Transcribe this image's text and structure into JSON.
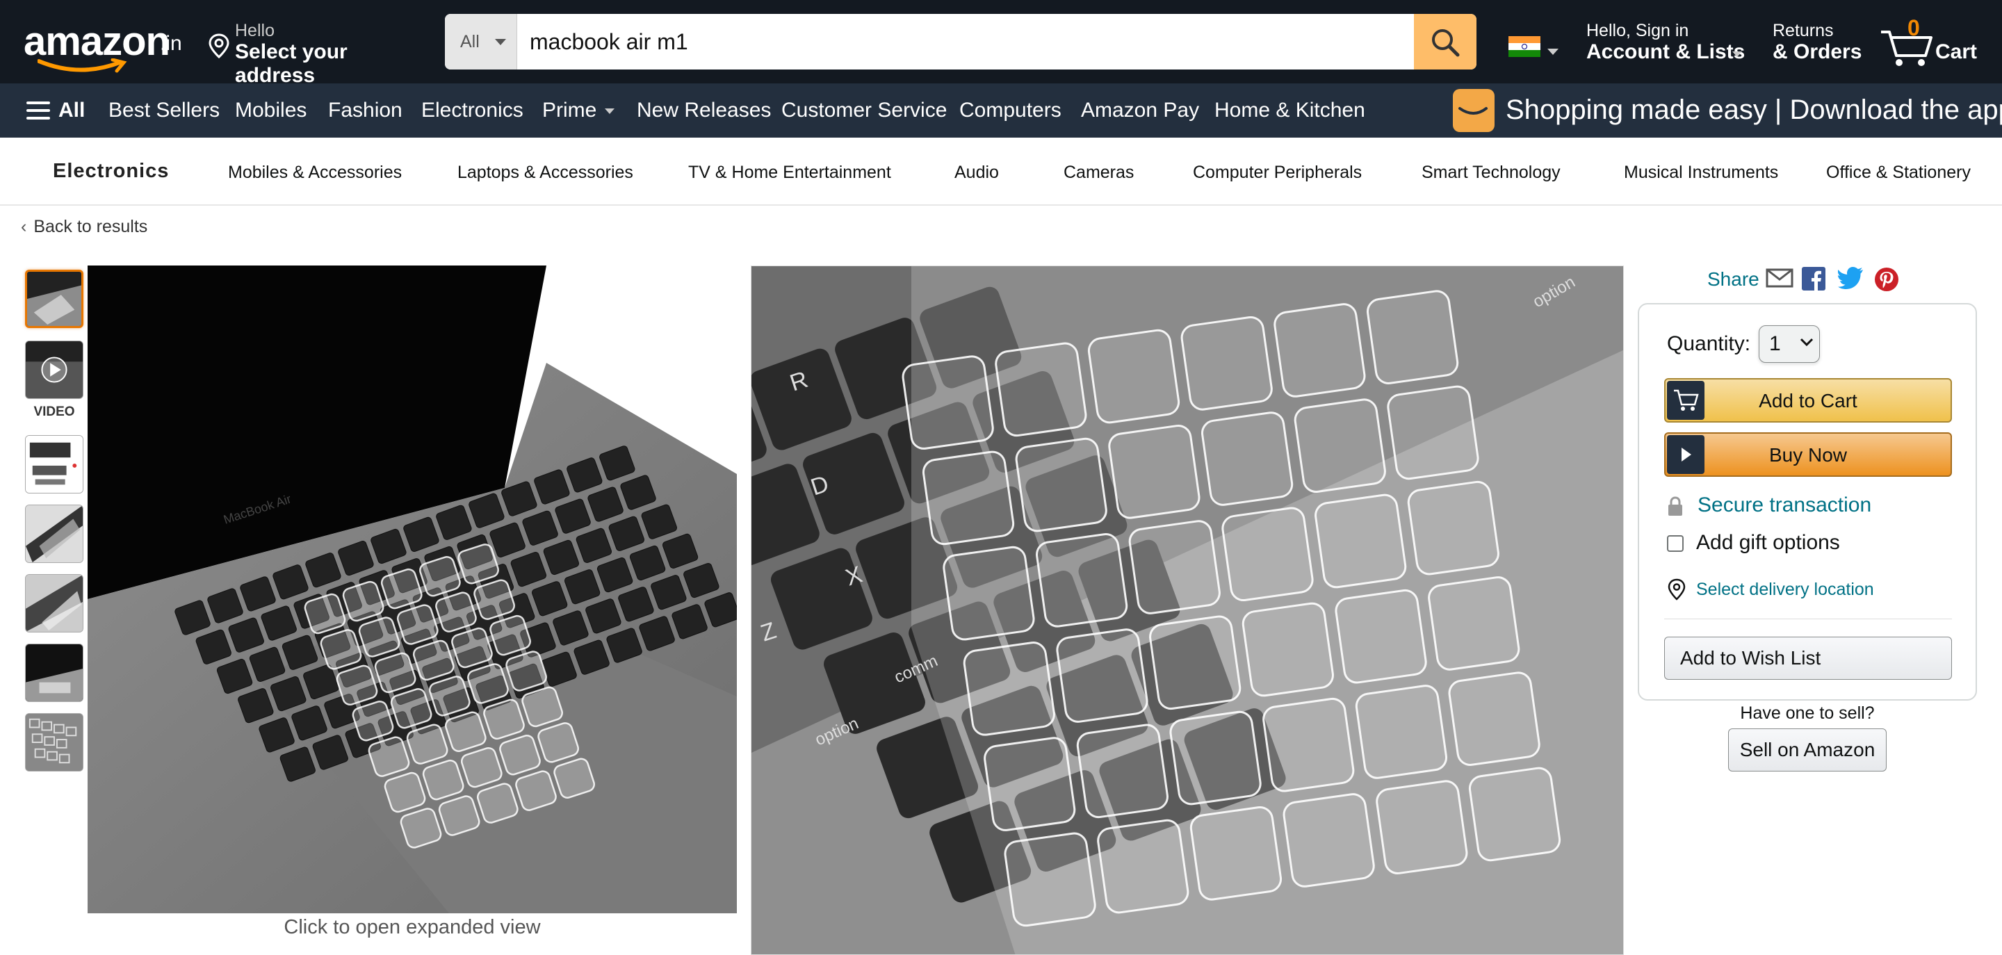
{
  "header": {
    "logo_text": "amazon",
    "logo_tld": ".in",
    "address_greeting": "Hello",
    "address_action": "Select your address",
    "search_category": "All",
    "search_value": "macbook air m1",
    "account_greeting": "Hello, Sign in",
    "account_label": "Account & Lists",
    "returns_line1": "Returns",
    "returns_line2": "& Orders",
    "cart_count": "0",
    "cart_label": "Cart"
  },
  "main_nav": {
    "all_label": "All",
    "items": [
      "Best Sellers",
      "Mobiles",
      "Fashion",
      "Electronics",
      "Prime",
      "New Releases",
      "Customer Service",
      "Computers",
      "Amazon Pay",
      "Home & Kitchen"
    ],
    "promo_text": "Shopping made easy | Download the app"
  },
  "subnav": {
    "title": "Electronics",
    "items": [
      "Mobiles & Accessories",
      "Laptops & Accessories",
      "TV & Home Entertainment",
      "Audio",
      "Cameras",
      "Computer Peripherals",
      "Smart Technology",
      "Musical Instruments",
      "Office & Stationery"
    ]
  },
  "breadcrumb": {
    "back_label": "Back to results"
  },
  "gallery": {
    "video_label": "VIDEO",
    "expand_hint": "Click to open expanded view"
  },
  "buybox": {
    "share_label": "Share",
    "quantity_label": "Quantity:",
    "quantity_value": "1",
    "add_to_cart": "Add to Cart",
    "buy_now": "Buy Now",
    "secure_transaction": "Secure transaction",
    "gift_options": "Add gift options",
    "delivery_location": "Select delivery location",
    "wish_list": "Add to Wish List",
    "sell_question": "Have one to sell?",
    "sell_button": "Sell on Amazon"
  },
  "colors": {
    "nav_dark": "#131921",
    "nav_secondary": "#232f3e",
    "search_button": "#febd69",
    "cart_count": "#f08804",
    "link": "#007185",
    "add_to_cart": "#f0c14b",
    "buy_now": "#ed9220"
  }
}
